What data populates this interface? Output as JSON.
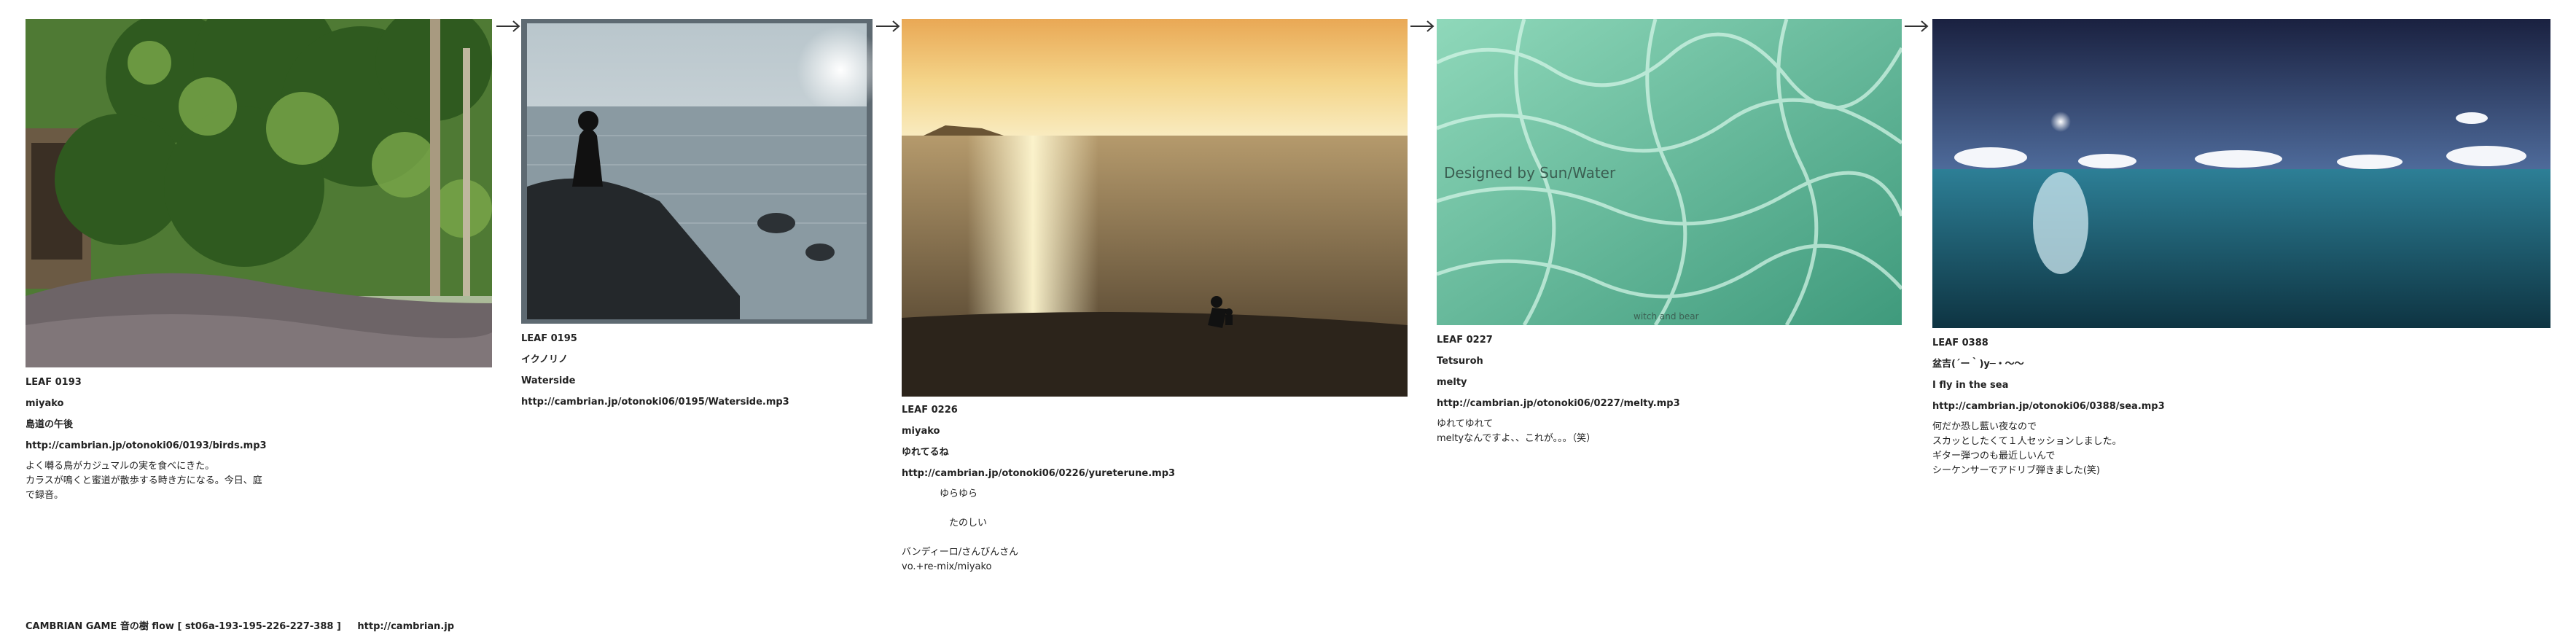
{
  "arrow_glyph": "→",
  "leaves": [
    {
      "code": "LEAF 0193",
      "artist": "miyako",
      "title": "島道の午後",
      "url": "http://cambrian.jp/otonoki06/0193/birds.mp3",
      "desc": [
        "よく囀る鳥がカジュマルの実を食べにきた。",
        "カラスが鳴くと蜜道が散歩する時き方になる。今日、庭",
        "で録音。"
      ]
    },
    {
      "code": "LEAF 0195",
      "artist": "イクノリノ",
      "title": "Waterside",
      "url": "http://cambrian.jp/otonoki06/0195/Waterside.mp3",
      "desc": []
    },
    {
      "code": "LEAF 0226",
      "artist": "miyako",
      "title": "ゆれてるね",
      "url": "http://cambrian.jp/otonoki06/0226/yureterune.mp3",
      "desc": [
        "　　　　ゆらゆら",
        "",
        "　　　　　たのしい",
        "",
        "バンディーロ/さんびんさん",
        "vo.+re-mix/miyako"
      ]
    },
    {
      "code": "LEAF 0227",
      "artist": "Tetsuroh",
      "title": "melty",
      "url": "http://cambrian.jp/otonoki06/0227/melty.mp3",
      "desc": [
        "ゆれてゆれて",
        "meltyなんですよ、、これが。。。（笑）"
      ],
      "watermark": "Designed by Sun/Water",
      "watermark2": "witch and bear"
    },
    {
      "code": "LEAF 0388",
      "artist": "盆吉(´ー｀)y─・～～",
      "title": "I fly in the sea",
      "url": "http://cambrian.jp/otonoki06/0388/sea.mp3",
      "desc": [
        "何だか恐し藍い夜なので",
        "スカッとしたくて１人セッションしました。",
        "ギター弾つのも最近しいんで",
        "シーケンサーでアドリブ弾きました(笑)"
      ]
    }
  ],
  "footer": {
    "site": "CAMBRIAN GAME 音の樹 flow [ st06a-193-195-226-227-388 ]",
    "link": "http://cambrian.jp"
  }
}
